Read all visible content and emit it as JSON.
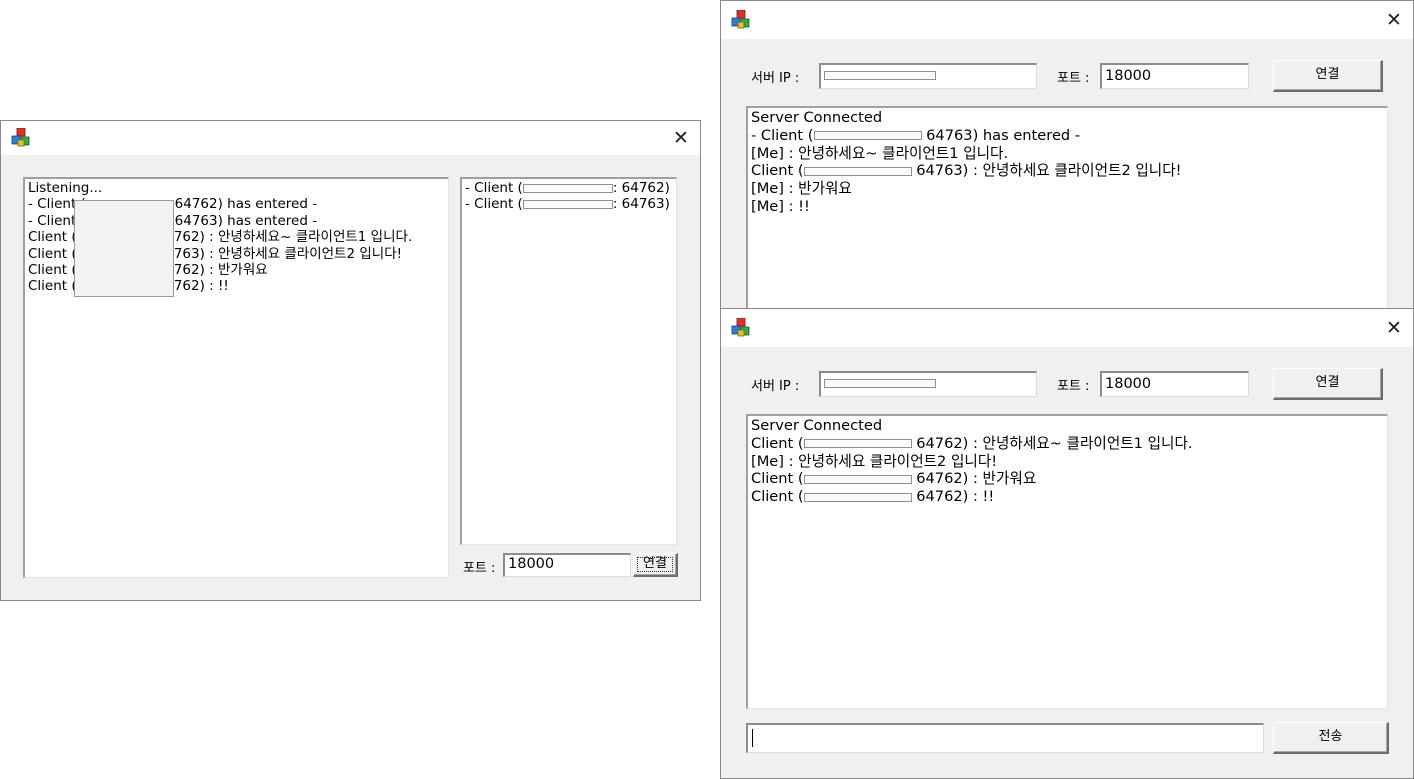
{
  "server_window": {
    "close_glyph": "✕",
    "log_lines": [
      {
        "text": "Listening..."
      },
      {
        "prefix": "- Client (",
        "suffix": ": 64762) has entered -"
      },
      {
        "prefix": "- Client (",
        "suffix": ": 64763) has entered -"
      },
      {
        "prefix": "Client (",
        "suffix": "64762) : 안녕하세요~ 클라이언트1 입니다."
      },
      {
        "prefix": "Client (",
        "suffix": "64763) : 안녕하세요 클라이언트2 입니다!"
      },
      {
        "prefix": "Client (",
        "suffix": "64762) : 반가워요"
      },
      {
        "prefix": "Client (",
        "suffix": "64762) : !!"
      }
    ],
    "client_list": [
      {
        "prefix": "- Client (",
        "suffix": ": 64762)"
      },
      {
        "prefix": "- Client (",
        "suffix": ": 64763)"
      }
    ],
    "port_label": "포트 :",
    "port_value": "18000",
    "connect_button": "연결"
  },
  "client1_window": {
    "close_glyph": "✕",
    "server_ip_label": "서버 IP :",
    "server_ip_value": "",
    "port_label": "포트 :",
    "port_value": "18000",
    "connect_button": "연결",
    "log_lines": [
      {
        "text": "Server Connected"
      },
      {
        "prefix": "- Client (",
        "suffix": " 64763) has entered -"
      },
      {
        "text": "[Me] : 안녕하세요~ 클라이언트1 입니다."
      },
      {
        "prefix": "Client (",
        "suffix": " 64763) : 안녕하세요 클라이언트2 입니다!"
      },
      {
        "text": "[Me] : 반가워요"
      },
      {
        "text": "[Me] : !!"
      }
    ]
  },
  "client2_window": {
    "close_glyph": "✕",
    "server_ip_label": "서버 IP :",
    "server_ip_value": "",
    "port_label": "포트 :",
    "port_value": "18000",
    "connect_button": "연결",
    "log_lines": [
      {
        "text": "Server Connected"
      },
      {
        "prefix": "Client (",
        "suffix": " 64762) : 안녕하세요~ 클라이언트1 입니다."
      },
      {
        "text": "[Me] : 안녕하세요 클라이언트2 입니다!"
      },
      {
        "prefix": "Client (",
        "suffix": " 64762) : 반가워요"
      },
      {
        "prefix": "Client (",
        "suffix": " 64762) : !!"
      }
    ],
    "message_input_value": "",
    "send_button": "전송"
  }
}
